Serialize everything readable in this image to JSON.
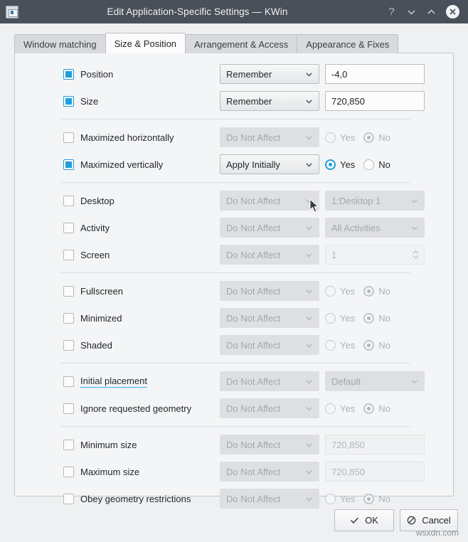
{
  "window": {
    "title": "Edit Application-Specific Settings — KWin",
    "app_icon": "window-settings-icon",
    "buttons": {
      "help": "?",
      "minimize": "chevron-down-icon",
      "maximize": "chevron-up-icon",
      "close": "close-icon"
    }
  },
  "tabs": [
    {
      "label": "Window matching",
      "active": false
    },
    {
      "label": "Size & Position",
      "active": true
    },
    {
      "label": "Arrangement & Access",
      "active": false
    },
    {
      "label": "Appearance & Fixes",
      "active": false
    }
  ],
  "colors": {
    "accent": "#1f9ede",
    "link_underline": "#3daee9",
    "titlebar": "#4a5059",
    "panel_bg": "#f4f5f6",
    "disabled_text": "#a3a8ad"
  },
  "rule_options": {
    "do_not_affect": "Do Not Affect",
    "remember": "Remember",
    "apply_initially": "Apply Initially"
  },
  "yes_no": {
    "yes": "Yes",
    "no": "No"
  },
  "rows": [
    {
      "name": "position",
      "label": "Position",
      "checked": true,
      "rule": "Remember",
      "rule_enabled": true,
      "value_type": "text",
      "value": "-4,0",
      "value_enabled": true
    },
    {
      "name": "size",
      "label": "Size",
      "checked": true,
      "rule": "Remember",
      "rule_enabled": true,
      "value_type": "text",
      "value": "720,850",
      "value_enabled": true
    },
    {
      "name": "maximized-horizontally",
      "label": "Maximized horizontally",
      "checked": false,
      "rule": "Do Not Affect",
      "rule_enabled": false,
      "value_type": "radio",
      "value": "No",
      "value_enabled": false
    },
    {
      "name": "maximized-vertically",
      "label": "Maximized vertically",
      "checked": true,
      "rule": "Apply Initially",
      "rule_enabled": true,
      "value_type": "radio",
      "value": "Yes",
      "value_enabled": true
    },
    {
      "name": "desktop",
      "label": "Desktop",
      "checked": false,
      "rule": "Do Not Affect",
      "rule_enabled": false,
      "value_type": "combo",
      "value": "1:Desktop 1",
      "value_enabled": false
    },
    {
      "name": "activity",
      "label": "Activity",
      "checked": false,
      "rule": "Do Not Affect",
      "rule_enabled": false,
      "value_type": "combo",
      "value": "All Activities",
      "value_enabled": false
    },
    {
      "name": "screen",
      "label": "Screen",
      "checked": false,
      "rule": "Do Not Affect",
      "rule_enabled": false,
      "value_type": "spin",
      "value": "1",
      "value_enabled": false
    },
    {
      "name": "fullscreen",
      "label": "Fullscreen",
      "checked": false,
      "rule": "Do Not Affect",
      "rule_enabled": false,
      "value_type": "radio",
      "value": "No",
      "value_enabled": false
    },
    {
      "name": "minimized",
      "label": "Minimized",
      "checked": false,
      "rule": "Do Not Affect",
      "rule_enabled": false,
      "value_type": "radio",
      "value": "No",
      "value_enabled": false
    },
    {
      "name": "shaded",
      "label": "Shaded",
      "checked": false,
      "rule": "Do Not Affect",
      "rule_enabled": false,
      "value_type": "radio",
      "value": "No",
      "value_enabled": false
    },
    {
      "name": "initial-placement",
      "label": "Initial placement",
      "label_link": true,
      "checked": false,
      "rule": "Do Not Affect",
      "rule_enabled": false,
      "value_type": "combo",
      "value": "Default",
      "value_enabled": false
    },
    {
      "name": "ignore-requested-geometry",
      "label": "Ignore requested geometry",
      "checked": false,
      "rule": "Do Not Affect",
      "rule_enabled": false,
      "value_type": "radio",
      "value": "No",
      "value_enabled": false
    },
    {
      "name": "minimum-size",
      "label": "Minimum size",
      "checked": false,
      "rule": "Do Not Affect",
      "rule_enabled": false,
      "value_type": "text",
      "value": "720,850",
      "value_enabled": false
    },
    {
      "name": "maximum-size",
      "label": "Maximum size",
      "checked": false,
      "rule": "Do Not Affect",
      "rule_enabled": false,
      "value_type": "text",
      "value": "720,850",
      "value_enabled": false
    },
    {
      "name": "obey-geometry-restrictions",
      "label": "Obey geometry restrictions",
      "checked": false,
      "rule": "Do Not Affect",
      "rule_enabled": false,
      "value_type": "radio",
      "value": "No",
      "value_enabled": false
    }
  ],
  "separators_after": [
    1,
    3,
    6,
    9,
    11
  ],
  "footer": {
    "ok_label": "OK",
    "ok_icon": "check-icon",
    "cancel_label": "Cancel",
    "cancel_icon": "no-entry-icon"
  },
  "watermark": "wsxdn.com"
}
